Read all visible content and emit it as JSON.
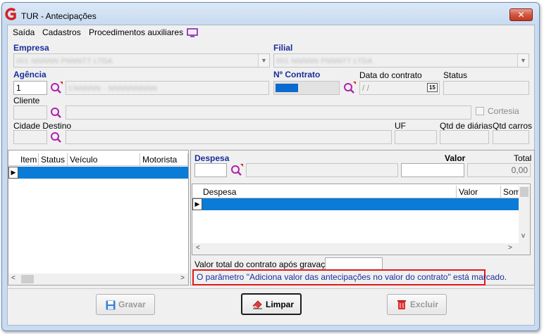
{
  "window": {
    "title": "TUR - Antecipações",
    "close_glyph": "✕"
  },
  "menu": {
    "items": [
      "Saída",
      "Cadastros",
      "Procedimentos auxiliares"
    ],
    "screen_icon": "monitor-icon"
  },
  "form": {
    "empresa_label": "Empresa",
    "empresa_value": "001 NNNNN PNNNTT LTDA",
    "filial_label": "Filial",
    "filial_value": "001 NNNNN PNNNTT LTDA",
    "agencia_label": "Agência",
    "agencia_code": "1",
    "agencia_name": "CNNNNN - NNNNNNNNN",
    "contrato_label": "Nº Contrato",
    "data_contrato_label": "Data do contrato",
    "data_contrato_value": " / /",
    "calendar_glyph": "15",
    "status_label": "Status",
    "cliente_label": "Cliente",
    "cortesia_label": "Cortesia",
    "cidade_label": "Cidade Destino",
    "uf_label": "UF",
    "qtd_diarias_label": "Qtd de diárias",
    "qtd_carros_label": "Qtd carros"
  },
  "vehicle_grid": {
    "columns": [
      "Item",
      "Status",
      "Veículo",
      "Motorista"
    ]
  },
  "despesa": {
    "label": "Despesa",
    "valor_label": "Valor",
    "total_label": "Total",
    "total_value": "0,00",
    "grid_columns": [
      "Despesa",
      "Valor",
      "Som"
    ]
  },
  "footer": {
    "valor_total_label": "Valor total do contrato após gravação",
    "notice": "O parâmetro \"Adiciona valor das antecipações no valor do contrato\" está marcado."
  },
  "buttons": {
    "gravar": "Gravar",
    "limpar": "Limpar",
    "excluir": "Excluir"
  },
  "colors": {
    "accent": "#1a2e9a",
    "selection": "#0a7bd6",
    "notice_border": "#e11919",
    "lookup": "#b01fb0"
  }
}
